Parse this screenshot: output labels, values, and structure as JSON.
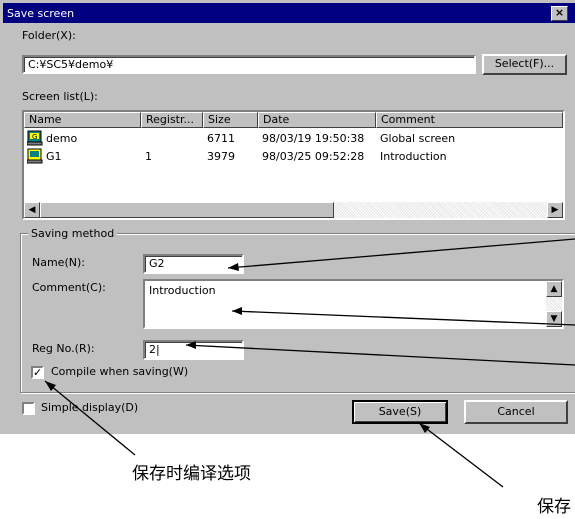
{
  "window": {
    "title": "Save screen",
    "close_glyph": "×"
  },
  "folder": {
    "label": "Folder(X):",
    "value": "C:¥SC5¥demo¥",
    "select_button": "Select(F)..."
  },
  "screen_list": {
    "label": "Screen list(L):",
    "columns": [
      "Name",
      "Registr...",
      "Size",
      "Date",
      "Comment"
    ],
    "rows": [
      {
        "icon": "global-screen-icon",
        "name": "demo",
        "registration": "",
        "size": "6711",
        "date": "98/03/19 19:50:38",
        "comment": "Global screen"
      },
      {
        "icon": "screen-icon",
        "name": "G1",
        "registration": "1",
        "size": "3979",
        "date": "98/03/25 09:52:28",
        "comment": "Introduction"
      }
    ]
  },
  "saving_method": {
    "group_label": "Saving method",
    "name_label": "Name(N):",
    "name_value": "G2",
    "comment_label": "Comment(C):",
    "comment_value": "Introduction",
    "reg_label": "Reg No.(R):",
    "reg_value": "2|",
    "compile_label": "Compile when saving(W)",
    "compile_checked": true
  },
  "simple_display": {
    "label": "Simple display(D)",
    "checked": false
  },
  "buttons": {
    "save": "Save(S)",
    "cancel": "Cancel"
  },
  "annotations": {
    "compile_option": "保存时编译选项",
    "save_partial": "保存"
  }
}
